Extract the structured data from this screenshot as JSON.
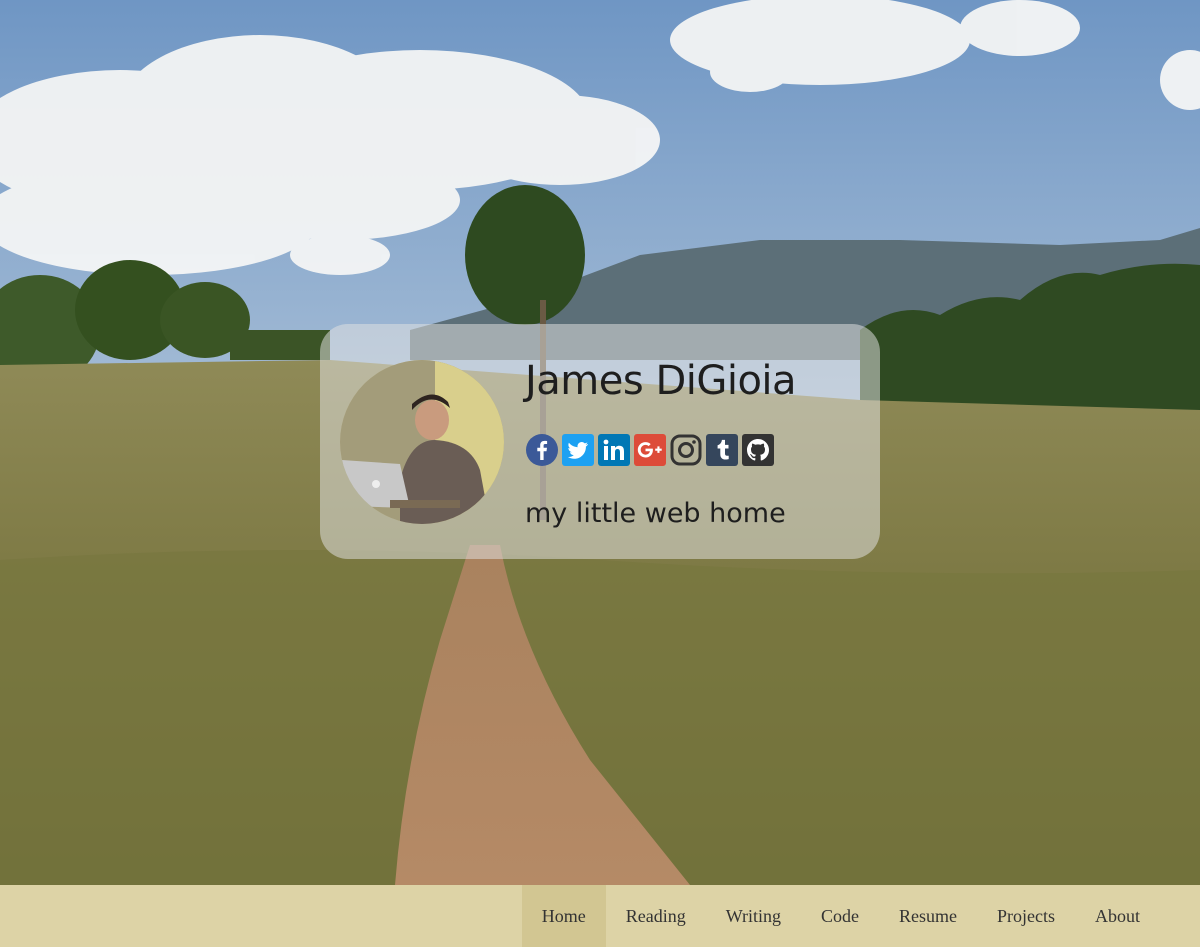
{
  "profile": {
    "name": "James DiGioia",
    "tagline": "my little web home",
    "avatar_alt": "avatar"
  },
  "social": [
    {
      "icon": "facebook-icon",
      "label": "facebook",
      "color": "#3b5998",
      "glyph": "f"
    },
    {
      "icon": "twitter-icon",
      "label": "twitter",
      "color": "#1da1f2",
      "glyph": "t"
    },
    {
      "icon": "linkedin-icon",
      "label": "linkedin",
      "color": "#0077b5",
      "glyph": "in"
    },
    {
      "icon": "google-plus-icon",
      "label": "google-plus",
      "color": "#dd4b39",
      "glyph": "G+"
    },
    {
      "icon": "instagram-icon",
      "label": "instagram",
      "color": "#333333",
      "glyph": "ig"
    },
    {
      "icon": "tumblr-icon",
      "label": "tumblr",
      "color": "#35465c",
      "glyph": "t"
    },
    {
      "icon": "github-icon",
      "label": "github",
      "color": "#333333",
      "glyph": "gh"
    }
  ],
  "nav": {
    "items": [
      {
        "label": "Home",
        "active": true
      },
      {
        "label": "Reading",
        "active": false
      },
      {
        "label": "Writing",
        "active": false
      },
      {
        "label": "Code",
        "active": false
      },
      {
        "label": "Resume",
        "active": false
      },
      {
        "label": "Projects",
        "active": false
      },
      {
        "label": "About",
        "active": false
      }
    ]
  },
  "colors": {
    "nav_background": "#ddd3a6",
    "nav_active": "#d2c692",
    "card_background": "rgba(226,226,226,0.52)",
    "text": "#1e1e1e"
  }
}
